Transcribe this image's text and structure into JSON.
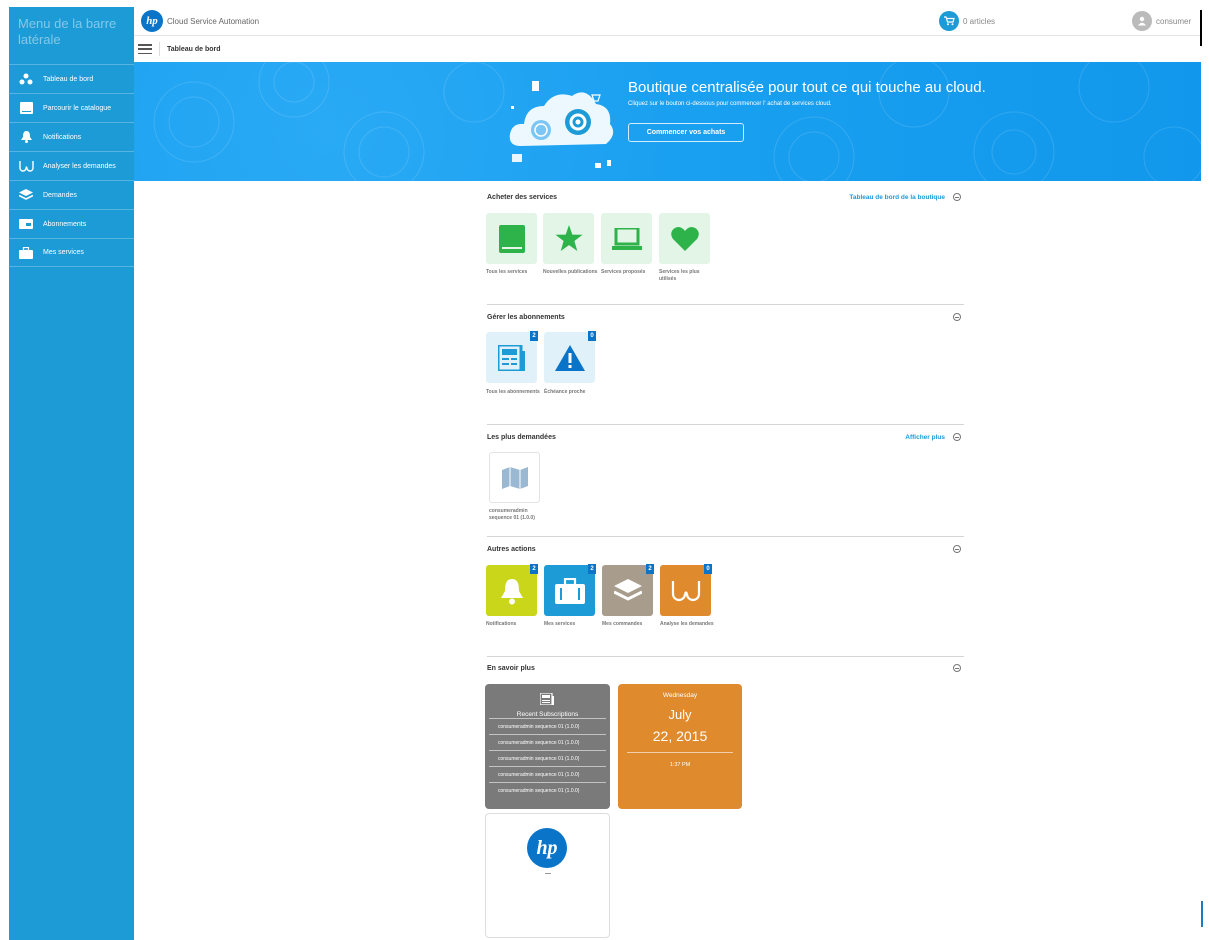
{
  "sidebar": {
    "title": "Menu de la barre latérale",
    "items": [
      {
        "label": "Tableau de bord",
        "icon": "dashboard-icon"
      },
      {
        "label": "Parcourir le catalogue",
        "icon": "catalog-book-icon"
      },
      {
        "label": "Notifications",
        "icon": "bell-icon"
      },
      {
        "label": "Analyser les demandes",
        "icon": "glasses-icon"
      },
      {
        "label": "Demandes",
        "icon": "layers-icon"
      },
      {
        "label": "Abonnements",
        "icon": "subscription-icon"
      },
      {
        "label": "Mes services",
        "icon": "briefcase-icon"
      }
    ]
  },
  "header": {
    "app_name": "Cloud Service Automation",
    "logo_text": "hp",
    "cart_label": "0 articles",
    "user_name": "consumer"
  },
  "breadcrumb": {
    "title": "Tableau de bord"
  },
  "banner": {
    "heading": "Boutique centralisée pour tout ce qui touche au cloud.",
    "subtext": "Cliquez sur le bouton ci-dessous pour commencer l' achat de services cloud.",
    "button": "Commencer vos achats"
  },
  "sections": {
    "buy": {
      "title": "Acheter des services",
      "link": "Tableau de bord de la boutique",
      "tiles": [
        {
          "label": "Tous les services",
          "icon": "book-icon"
        },
        {
          "label": "Nouvelles publications",
          "icon": "star-icon"
        },
        {
          "label": "Services proposés",
          "icon": "laptop-icon"
        },
        {
          "label": "Services les plus utilisés",
          "icon": "heart-icon"
        }
      ]
    },
    "subs": {
      "title": "Gérer les abonnements",
      "tiles": [
        {
          "label": "Tous les abonnements",
          "badge": "2",
          "icon": "newspaper-icon"
        },
        {
          "label": "Échéance proche",
          "badge": "0",
          "icon": "warning-icon"
        }
      ]
    },
    "popular": {
      "title": "Les plus demandées",
      "link": "Afficher plus",
      "tiles": [
        {
          "label": "consumeradmin sequence 01 (1.0.0)",
          "icon": "map-icon"
        }
      ]
    },
    "other": {
      "title": "Autres actions",
      "tiles": [
        {
          "label": "Notifications",
          "badge": "2",
          "color": "#c9d61a",
          "icon": "bell-icon"
        },
        {
          "label": "Mes services",
          "badge": "2",
          "color": "#1d9bd6",
          "icon": "briefcase-icon"
        },
        {
          "label": "Mes commandes",
          "badge": "2",
          "color": "#a89d8c",
          "icon": "layers-icon"
        },
        {
          "label": "Analyse les demandes",
          "badge": "0",
          "color": "#e08a2e",
          "icon": "glasses-icon"
        }
      ]
    },
    "learn": {
      "title": "En savoir plus"
    }
  },
  "widgets": {
    "recent": {
      "title": "Recent Subscriptions",
      "rows": [
        "consumeradmin sequence 01 (1.0.0)",
        "consumeradmin sequence 01 (1.0.0)",
        "consumeradmin sequence 01 (1.0.0)",
        "consumeradmin sequence 01 (1.0.0)",
        "consumeradmin sequence 01 (1.0.0)"
      ]
    },
    "calendar": {
      "weekday": "Wednesday",
      "month": "July",
      "date": "22, 2015",
      "time": "1:37 PM"
    },
    "logo_text": "hp"
  },
  "colors": {
    "sidebar": "#1d9bd6",
    "banner": "#1aa0f0",
    "green": "#2db34a",
    "green_bg": "#e3f5e6",
    "blue_bg": "#e1f1fa",
    "accent": "#1d9bd6"
  }
}
